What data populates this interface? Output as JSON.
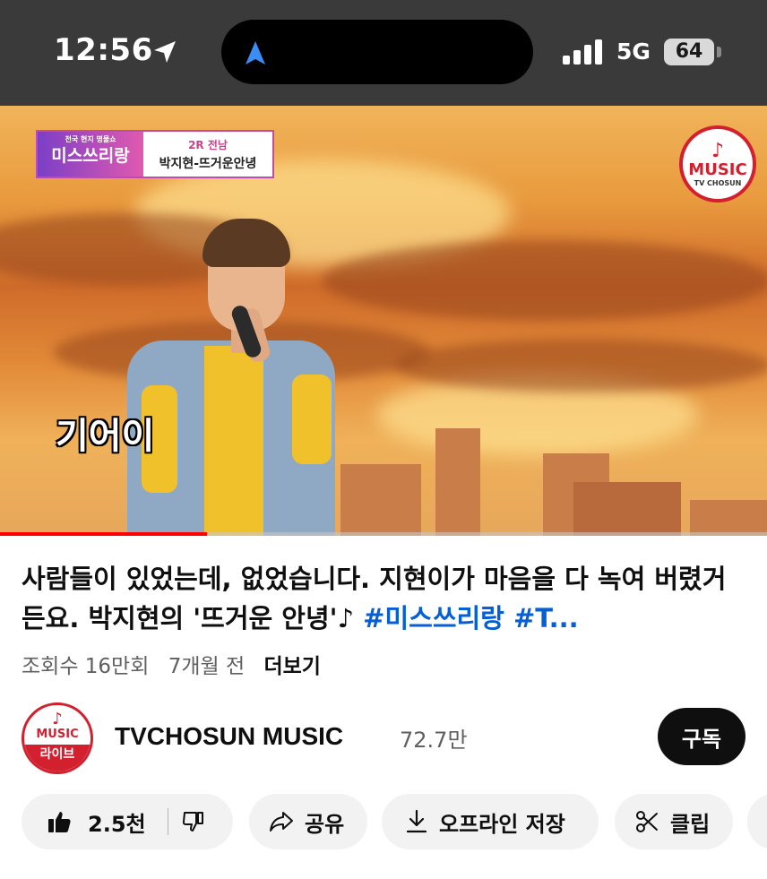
{
  "status_bar": {
    "time": "12:56",
    "network": "5G",
    "battery": "64"
  },
  "video": {
    "show_logo": "미스쓰리랑",
    "show_logo_sub": "전국 현지 명물쇼",
    "show_round": "2R 전남",
    "show_song": "박지현-뜨거운안녕",
    "channel_logo_word": "MUSIC",
    "channel_logo_sub": "TV CHOSUN",
    "caption": "기어이",
    "progress": 0.27
  },
  "details": {
    "title_main": "사람들이 있었는데, 없었습니다. 지현이가 마음을 다 녹여 버렸거든요. 박지현의 '뜨거운 안녕'♪ ",
    "title_tags": "#미스쓰리랑 #T...",
    "views": "조회수 16만회",
    "age": "7개월 전",
    "more": "더보기"
  },
  "channel": {
    "avatar_word": "MUSIC",
    "avatar_live": "라이브",
    "name": "TVCHOSUN MUSIC",
    "subscribers": "72.7만",
    "subscribe_label": "구독"
  },
  "actions": {
    "like_count": "2.5천",
    "share_label": "공유",
    "download_label": "오프라인 저장",
    "clip_label": "클립"
  },
  "colors": {
    "accent_red": "#d2202f",
    "link_blue": "#065fd4",
    "progress_red": "#ff0000"
  }
}
